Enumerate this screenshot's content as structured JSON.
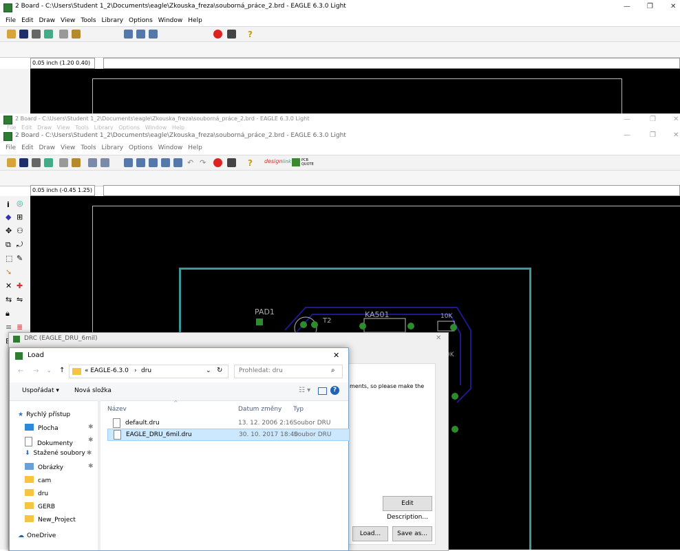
{
  "back_window": {
    "title": "2 Board - C:\\Users\\Student 1_2\\Documents\\eagle\\Zkouska_freza\\souborná_práce_2.brd - EAGLE 6.3.0 Light",
    "menu": [
      "File",
      "Edit",
      "Draw",
      "View",
      "Tools",
      "Library",
      "Options",
      "Window",
      "Help"
    ],
    "coord": "0.05 inch (1.20 0.40)"
  },
  "mid_window": {
    "title": "2 Board - C:\\Users\\Student 1_2\\Documents\\eagle\\Zkouska_freza\\souborná_práce_2.brd - EAGLE 6.3.0 Light",
    "menu_faded": "File   Edit   Draw   View   Tools   Library   Options   Window   Help"
  },
  "main_window": {
    "title": "2 Board - C:\\Users\\Student 1_2\\Documents\\eagle\\Zkouska_freza\\souborná_práce_2.brd - EAGLE 6.3.0 Light",
    "menu": [
      "File",
      "Edit",
      "Draw",
      "View",
      "Tools",
      "Library",
      "Options",
      "Window",
      "Help"
    ],
    "coord": "0.05 inch (-0.45 1.25)",
    "design_link": "design",
    "design_link_sub": "link",
    "pcb_quote": "PCB QUOTE"
  },
  "board": {
    "labels": {
      "pad1": "PAD1",
      "t2": "T2",
      "ka501": "KA501",
      "r10k": "10K",
      "r10k_2": "0K"
    }
  },
  "drc_dialog": {
    "title": "DRC (EAGLE_DRU_6mil)",
    "text": "ments, so please make the",
    "edit_description": "Edit Description...",
    "load": "Load...",
    "save_as": "Save as..."
  },
  "load_dialog": {
    "title": "Load",
    "path": [
      "« EAGLE-6.3.0",
      "dru"
    ],
    "search_placeholder": "Prohledat: dru",
    "organize": "Uspořádat ▾",
    "new_folder": "Nová složka",
    "columns": {
      "name": "Název",
      "date": "Datum změny",
      "type": "Typ"
    },
    "files": [
      {
        "name": "default.dru",
        "date": "13. 12. 2006 2:16",
        "type": "Soubor DRU"
      },
      {
        "name": "EAGLE_DRU_6mil.dru",
        "date": "30. 10. 2017 18:40",
        "type": "Soubor DRU"
      }
    ],
    "nav": {
      "quick_access": "Rychlý přístup",
      "items": [
        "Plocha",
        "Dokumenty",
        "Stažené soubory",
        "Obrázky",
        "cam",
        "dru",
        "GERB",
        "New_Project"
      ],
      "onedrive": "OneDrive"
    }
  },
  "colors": {
    "canvas": "#000000",
    "board_outline": "#3a9a9a",
    "trace": "#1a1a8c",
    "pad": "#2e8b2e",
    "selection": "#cce8ff"
  }
}
